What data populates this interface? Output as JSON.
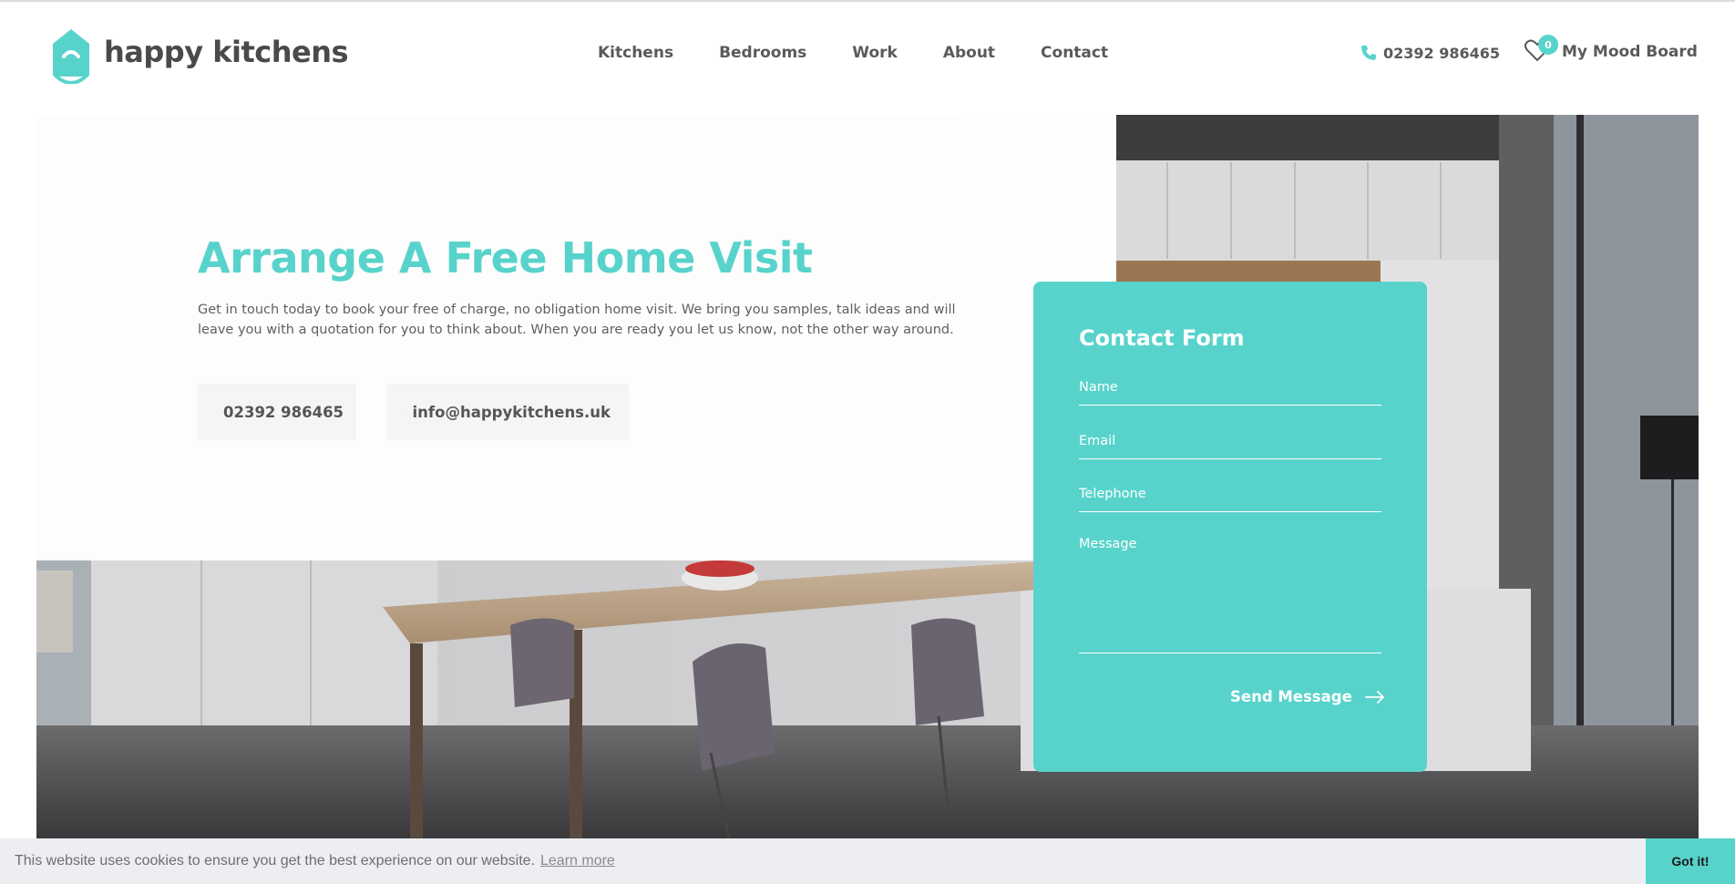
{
  "brand": {
    "name": "happy kitchens",
    "accent_color": "#58d3cb",
    "logo_icon": "house-smile-icon"
  },
  "nav": {
    "items": [
      {
        "label": "Kitchens"
      },
      {
        "label": "Bedrooms"
      },
      {
        "label": "Work"
      },
      {
        "label": "About"
      },
      {
        "label": "Contact"
      }
    ]
  },
  "header": {
    "phone": "02392 986465",
    "phone_icon": "phone-icon",
    "mood_board": {
      "label": "My Mood Board",
      "count": "0",
      "icon": "heart-icon"
    }
  },
  "hero": {
    "title": "Arrange A Free Home Visit",
    "description": "Get in touch today to book your free of charge, no obligation home visit. We bring you samples, talk ideas and will leave you with a quotation for you to think about. When you are ready you let us know, not the other way around.",
    "phone_button": "02392 986465",
    "email_button": "info@happykitchens.uk",
    "email_icon": "envelope-icon",
    "background": "kitchen-dining-photo"
  },
  "contact_form": {
    "title": "Contact Form",
    "name_placeholder": "Name",
    "email_placeholder": "Email",
    "telephone_placeholder": "Telephone",
    "message_placeholder": "Message",
    "submit_label": "Send Message",
    "submit_icon": "arrow-right-icon",
    "background_color": "#58d3cb"
  },
  "cookie_bar": {
    "message": "This website uses cookies to ensure you get the best experience on our website.",
    "learn_more": "Learn more",
    "accept_label": "Got it!"
  }
}
